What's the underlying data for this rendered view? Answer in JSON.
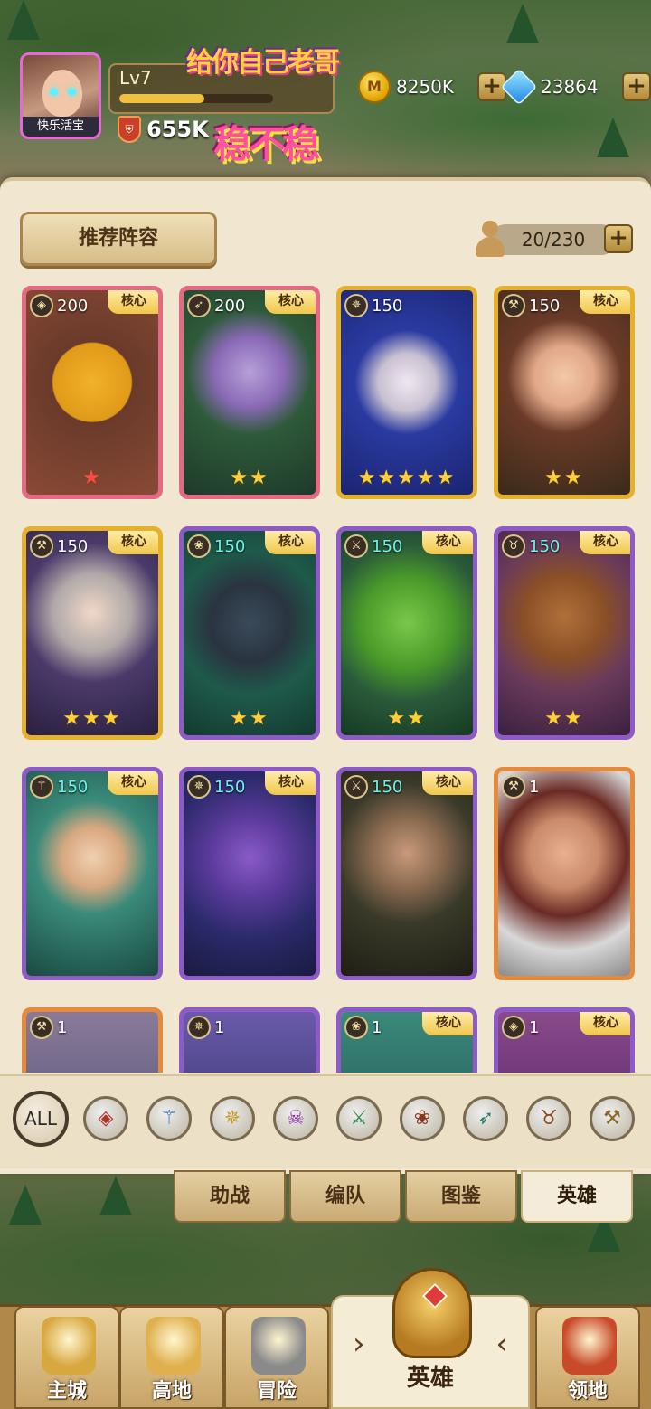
{
  "player": {
    "avatar_name": "快乐活宝",
    "level": "Lv7",
    "power": "655K",
    "level_progress": 0.55
  },
  "promo": {
    "line1": "给你自己老哥",
    "line2": "稳不稳"
  },
  "resources": {
    "gold": {
      "icon": "coin-icon",
      "value": "8250K"
    },
    "gems": {
      "icon": "diamond-icon",
      "value": "23864"
    }
  },
  "panel": {
    "recommend_label": "推荐阵容",
    "hero_count": "20/230"
  },
  "heroes": [
    {
      "level": "200",
      "core": "核心",
      "stars": "★",
      "star_color": "red",
      "frame": "pink",
      "class_icon": "shield-icon",
      "class_glyph": "◈"
    },
    {
      "level": "200",
      "core": "核心",
      "stars": "★★",
      "frame": "pink",
      "class_icon": "bow-icon",
      "class_glyph": "➶"
    },
    {
      "level": "150",
      "core": "",
      "stars": "★★★★★",
      "frame": "gold",
      "class_icon": "crest-icon",
      "class_glyph": "✵"
    },
    {
      "level": "150",
      "core": "核心",
      "stars": "★★",
      "frame": "gold",
      "class_icon": "axe-icon",
      "class_glyph": "⚒"
    },
    {
      "level": "150",
      "core": "核心",
      "stars": "★★★",
      "frame": "gold",
      "class_icon": "axe-icon",
      "class_glyph": "⚒"
    },
    {
      "level": "150",
      "core": "核心",
      "stars": "★★",
      "frame": "purple",
      "class_icon": "paw-icon",
      "class_glyph": "❀",
      "teal": true
    },
    {
      "level": "150",
      "core": "核心",
      "stars": "★★",
      "frame": "purple",
      "class_icon": "crossed-swords-icon",
      "class_glyph": "⚔",
      "teal": true
    },
    {
      "level": "150",
      "core": "核心",
      "stars": "★★",
      "frame": "purple",
      "class_icon": "bull-icon",
      "class_glyph": "♉",
      "teal": true
    },
    {
      "level": "150",
      "core": "核心",
      "stars": "",
      "frame": "purple",
      "class_icon": "staff-icon",
      "class_glyph": "⚚",
      "teal": true
    },
    {
      "level": "150",
      "core": "核心",
      "stars": "",
      "frame": "purple",
      "class_icon": "crest-icon",
      "class_glyph": "✵",
      "teal": true
    },
    {
      "level": "150",
      "core": "核心",
      "stars": "",
      "frame": "purple",
      "class_icon": "crossed-swords-icon",
      "class_glyph": "⚔",
      "teal": true
    },
    {
      "level": "1",
      "core": "",
      "stars": "",
      "frame": "orange",
      "class_icon": "axe-icon",
      "class_glyph": "⚒"
    },
    {
      "level": "1",
      "core": "",
      "stars": "",
      "frame": "orange",
      "class_icon": "axe-icon",
      "class_glyph": "⚒"
    },
    {
      "level": "1",
      "core": "",
      "stars": "",
      "frame": "purple",
      "class_icon": "crest-icon",
      "class_glyph": "✵"
    },
    {
      "level": "1",
      "core": "核心",
      "stars": "",
      "frame": "purple",
      "class_icon": "paw-icon",
      "class_glyph": "❀"
    },
    {
      "level": "1",
      "core": "核心",
      "stars": "",
      "frame": "purple",
      "class_icon": "shield-icon",
      "class_glyph": "◈"
    }
  ],
  "filters": [
    {
      "label": "ALL",
      "icon": "all-filter"
    },
    {
      "icon": "shield-icon",
      "glyph": "◈",
      "color": "#b0342a"
    },
    {
      "icon": "staff-icon",
      "glyph": "⚚",
      "color": "#2a6aa8"
    },
    {
      "icon": "crest-icon",
      "glyph": "✵",
      "color": "#c49a2a"
    },
    {
      "icon": "skull-icon",
      "glyph": "☠",
      "color": "#8a2aa8"
    },
    {
      "icon": "crossed-swords-icon",
      "glyph": "⚔",
      "color": "#2a8a4a"
    },
    {
      "icon": "paw-icon",
      "glyph": "❀",
      "color": "#8a3a1a"
    },
    {
      "icon": "bow-icon",
      "glyph": "➶",
      "color": "#2a7a6a"
    },
    {
      "icon": "bull-icon",
      "glyph": "♉",
      "color": "#8a4a1a"
    },
    {
      "icon": "axe-icon",
      "glyph": "⚒",
      "color": "#8a6a2a"
    }
  ],
  "sub_tabs": [
    "助战",
    "编队",
    "图鉴",
    "英雄"
  ],
  "sub_tab_active": "英雄",
  "nav": {
    "items": [
      "主城",
      "高地",
      "冒险",
      "英雄",
      "领地"
    ],
    "active": "英雄"
  }
}
